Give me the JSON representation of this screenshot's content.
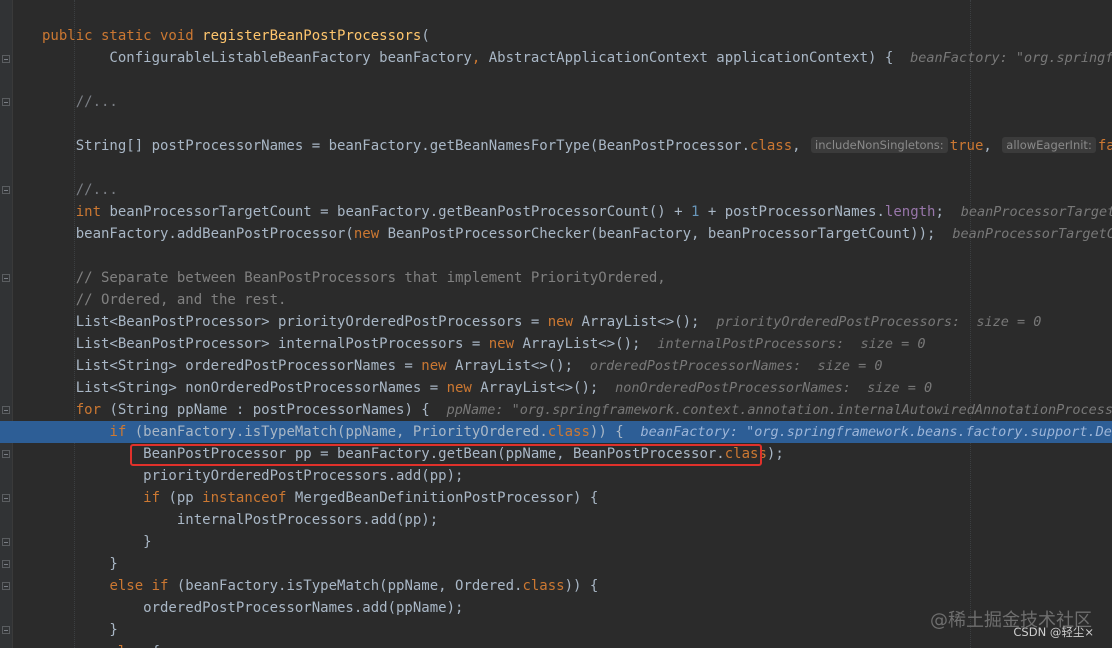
{
  "editor": {
    "lines": [
      {
        "tokens": [
          {
            "t": "public static void ",
            "c": "kw"
          },
          {
            "t": "registerBeanPostProcessors",
            "c": "fn"
          },
          {
            "t": "("
          }
        ]
      },
      {
        "tokens": [
          {
            "t": "        ConfigurableListableBeanFactory beanFactory"
          },
          {
            "t": ", ",
            "c": "kw"
          },
          {
            "t": "AbstractApplicationContext applicationContext) {  "
          },
          {
            "t": "beanFactory: \"org.springframework",
            "c": "hint"
          }
        ]
      },
      {
        "blank": true
      },
      {
        "tokens": [
          {
            "t": "    //...",
            "c": "fold"
          }
        ]
      },
      {
        "blank": true
      },
      {
        "tokens": [
          {
            "t": "    String[] postProcessorNames = beanFactory.getBeanNamesForType(BeanPostProcessor."
          },
          {
            "t": "class",
            "c": "kw"
          },
          {
            "t": ", "
          },
          {
            "t": "includeNonSingletons:",
            "c": "param-hint"
          },
          {
            "t": "true",
            "c": "kw"
          },
          {
            "t": ", "
          },
          {
            "t": "allowEagerInit:",
            "c": "param-hint"
          },
          {
            "t": "false",
            "c": "kw"
          },
          {
            "t": ");"
          }
        ]
      },
      {
        "blank": true
      },
      {
        "tokens": [
          {
            "t": "    //...",
            "c": "fold"
          }
        ]
      },
      {
        "tokens": [
          {
            "t": "    "
          },
          {
            "t": "int ",
            "c": "kw"
          },
          {
            "t": "beanProcessorTargetCount = beanFactory.getBeanPostProcessorCount() + "
          },
          {
            "t": "1",
            "c": "num"
          },
          {
            "t": " + postProcessorNames."
          },
          {
            "t": "length",
            "c": "fld"
          },
          {
            "t": ";  "
          },
          {
            "t": "beanProcessorTargetCount",
            "c": "hint"
          }
        ]
      },
      {
        "tokens": [
          {
            "t": "    beanFactory.addBeanPostProcessor("
          },
          {
            "t": "new ",
            "c": "kw"
          },
          {
            "t": "BeanPostProcessorChecker(beanFactory, beanProcessorTargetCount));  "
          },
          {
            "t": "beanProcessorTargetCount:",
            "c": "hint"
          }
        ]
      },
      {
        "blank": true
      },
      {
        "tokens": [
          {
            "t": "    // Separate between BeanPostProcessors that implement PriorityOrdered,",
            "c": "cmt"
          }
        ]
      },
      {
        "tokens": [
          {
            "t": "    // Ordered, and the rest.",
            "c": "cmt"
          }
        ]
      },
      {
        "tokens": [
          {
            "t": "    List<BeanPostProcessor> priorityOrderedPostProcessors = "
          },
          {
            "t": "new ",
            "c": "kw"
          },
          {
            "t": "ArrayList<>();  "
          },
          {
            "t": "priorityOrderedPostProcessors:  size = 0",
            "c": "hint"
          }
        ]
      },
      {
        "tokens": [
          {
            "t": "    List<BeanPostProcessor> internalPostProcessors = "
          },
          {
            "t": "new ",
            "c": "kw"
          },
          {
            "t": "ArrayList<>();  "
          },
          {
            "t": "internalPostProcessors:  size = 0",
            "c": "hint"
          }
        ]
      },
      {
        "tokens": [
          {
            "t": "    List<String> orderedPostProcessorNames = "
          },
          {
            "t": "new ",
            "c": "kw"
          },
          {
            "t": "ArrayList<>();  "
          },
          {
            "t": "orderedPostProcessorNames:  size = 0",
            "c": "hint"
          }
        ]
      },
      {
        "tokens": [
          {
            "t": "    List<String> nonOrderedPostProcessorNames = "
          },
          {
            "t": "new ",
            "c": "kw"
          },
          {
            "t": "ArrayList<>();  "
          },
          {
            "t": "nonOrderedPostProcessorNames:  size = 0",
            "c": "hint"
          }
        ]
      },
      {
        "tokens": [
          {
            "t": "    "
          },
          {
            "t": "for ",
            "c": "kw"
          },
          {
            "t": "(String ppName : postProcessorNames) {  "
          },
          {
            "t": "ppName: \"org.springframework.context.annotation.internalAutowiredAnnotationProcessor\"",
            "c": "hint"
          }
        ]
      },
      {
        "current": true,
        "tokens": [
          {
            "t": "        "
          },
          {
            "t": "if ",
            "c": "kw"
          },
          {
            "t": "(beanFactory.isTypeMatch(ppName, PriorityOrdered."
          },
          {
            "t": "class",
            "c": "kw"
          },
          {
            "t": ")) {  "
          },
          {
            "t": "beanFactory: \"org.springframework.beans.factory.support.DefaultL",
            "c": "hint"
          }
        ]
      },
      {
        "tokens": [
          {
            "t": "            BeanPostProcessor pp = beanFactory.getBean(ppName, BeanPostProcessor."
          },
          {
            "t": "class",
            "c": "kw"
          },
          {
            "t": ");"
          }
        ]
      },
      {
        "tokens": [
          {
            "t": "            priorityOrderedPostProcessors.add(pp);"
          }
        ]
      },
      {
        "tokens": [
          {
            "t": "            "
          },
          {
            "t": "if ",
            "c": "kw"
          },
          {
            "t": "(pp "
          },
          {
            "t": "instanceof ",
            "c": "kw"
          },
          {
            "t": "MergedBeanDefinitionPostProcessor) {"
          }
        ]
      },
      {
        "tokens": [
          {
            "t": "                internalPostProcessors.add(pp);"
          }
        ]
      },
      {
        "tokens": [
          {
            "t": "            }"
          }
        ]
      },
      {
        "tokens": [
          {
            "t": "        }"
          }
        ]
      },
      {
        "tokens": [
          {
            "t": "        "
          },
          {
            "t": "else if ",
            "c": "kw"
          },
          {
            "t": "(beanFactory.isTypeMatch(ppName, Ordered."
          },
          {
            "t": "class",
            "c": "kw"
          },
          {
            "t": ")) {"
          }
        ]
      },
      {
        "tokens": [
          {
            "t": "            orderedPostProcessorNames.add(ppName);"
          }
        ]
      },
      {
        "tokens": [
          {
            "t": "        }"
          }
        ]
      },
      {
        "tokens": [
          {
            "t": "        "
          },
          {
            "t": "else ",
            "c": "kw"
          },
          {
            "t": "{"
          }
        ]
      }
    ]
  },
  "watermark": "@稀土掘金技术社区",
  "credit": "CSDN @轻尘×"
}
